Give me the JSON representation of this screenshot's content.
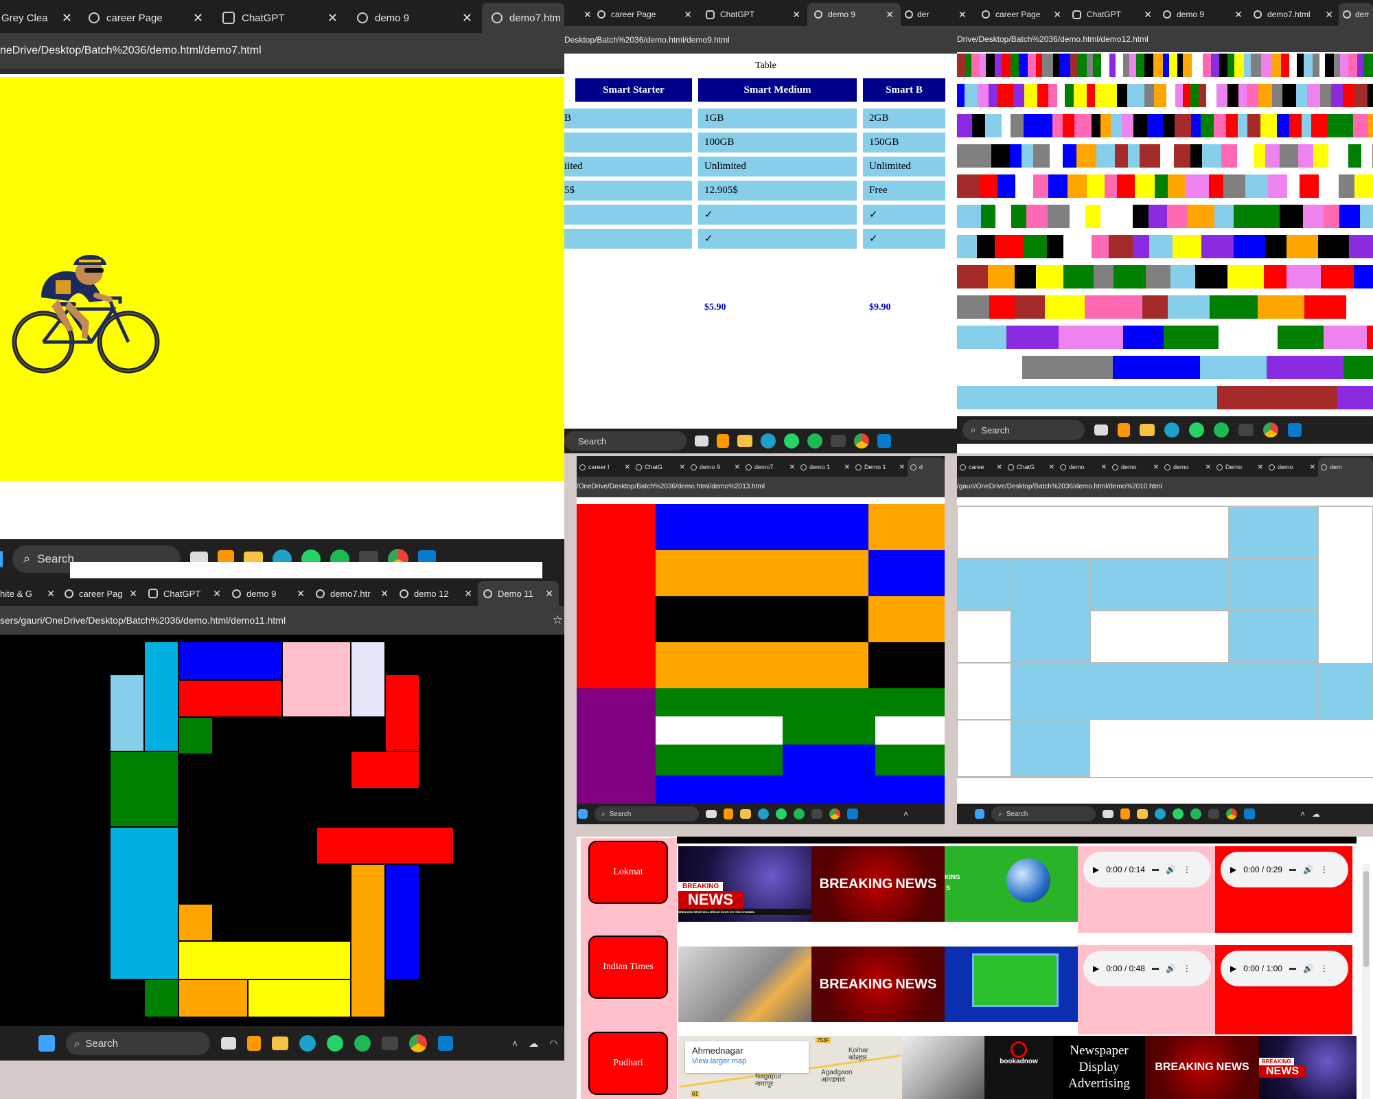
{
  "p1": {
    "tabs": [
      {
        "label": "Grey Clea",
        "icon": "none",
        "active": false
      },
      {
        "label": "career Page",
        "icon": "globe",
        "active": false
      },
      {
        "label": "ChatGPT",
        "icon": "gpt",
        "active": false
      },
      {
        "label": "demo 9",
        "icon": "globe",
        "active": false
      },
      {
        "label": "demo7.html",
        "icon": "globe",
        "active": true
      }
    ],
    "address": "neDrive/Desktop/Batch%2036/demo.html/demo7.html",
    "search_label": "Search",
    "cyclist_alt": "cyclist",
    "page_bg": "#ffff00"
  },
  "p2": {
    "tabs": [
      {
        "label": "",
        "icon": "none",
        "active": false
      },
      {
        "label": "career Page",
        "icon": "globe",
        "active": false
      },
      {
        "label": "ChatGPT",
        "icon": "gpt",
        "active": false
      },
      {
        "label": "demo 9",
        "icon": "globe",
        "active": true
      },
      {
        "label": "der",
        "icon": "globe",
        "active": false
      }
    ],
    "address": "Desktop/Batch%2036/demo.html/demo9.html",
    "caption": "Table",
    "headers": [
      "Smart Starter",
      "Smart Medium",
      "Smart B"
    ],
    "rows": [
      [
        "B",
        "1GB",
        "2GB"
      ],
      [
        "",
        "100GB",
        "150GB"
      ],
      [
        "iited",
        "Unlimited",
        "Unlimited"
      ],
      [
        "5$",
        "12.905$",
        "Free"
      ],
      [
        "",
        "✓",
        "✓"
      ],
      [
        "",
        "✓",
        "✓"
      ]
    ],
    "prices": [
      "",
      "$5.90",
      "$9.90"
    ],
    "search_label": "Search"
  },
  "p3": {
    "tabs": [
      {
        "label": "",
        "icon": "none",
        "active": false
      },
      {
        "label": "career Page",
        "icon": "globe",
        "active": false
      },
      {
        "label": "ChatGPT",
        "icon": "gpt",
        "active": false
      },
      {
        "label": "demo 9",
        "icon": "globe",
        "active": false
      },
      {
        "label": "demo7.html",
        "icon": "globe",
        "active": false
      },
      {
        "label": "dem",
        "icon": "globe",
        "active": true
      }
    ],
    "address": "Drive/Desktop/Batch%2036/demo.html/demo12.html",
    "search_label": "Search"
  },
  "p4": {
    "tabs": [
      {
        "label": "hite & G",
        "icon": "none",
        "active": false
      },
      {
        "label": "career Pag",
        "icon": "globe",
        "active": false
      },
      {
        "label": "ChatGPT",
        "icon": "gpt",
        "active": false
      },
      {
        "label": "demo 9",
        "icon": "globe",
        "active": false
      },
      {
        "label": "demo7.htr",
        "icon": "globe",
        "active": false
      },
      {
        "label": "demo 12",
        "icon": "globe",
        "active": false
      },
      {
        "label": "Demo 11",
        "icon": "globe",
        "active": true
      }
    ],
    "address": "sers/gauri/OneDrive/Desktop/Batch%2036/demo.html/demo11.html",
    "search_label": "Search"
  },
  "p5": {
    "tabs": [
      {
        "label": "career I",
        "icon": "globe",
        "active": false
      },
      {
        "label": "ChatG",
        "icon": "gpt",
        "active": false
      },
      {
        "label": "demo 9",
        "icon": "globe",
        "active": false
      },
      {
        "label": "demo7.",
        "icon": "globe",
        "active": false
      },
      {
        "label": "demo 1",
        "icon": "globe",
        "active": false
      },
      {
        "label": "Demo 1",
        "icon": "globe",
        "active": false
      },
      {
        "label": "d",
        "icon": "globe",
        "active": true
      }
    ],
    "address": "/OneDrive/Desktop/Batch%2036/demo.html/demo%2013.html",
    "search_label": "Search"
  },
  "p6": {
    "tabs": [
      {
        "label": "caree",
        "icon": "globe",
        "active": false
      },
      {
        "label": "ChatG",
        "icon": "gpt",
        "active": false
      },
      {
        "label": "demo",
        "icon": "globe",
        "active": false
      },
      {
        "label": "demo",
        "icon": "globe",
        "active": false
      },
      {
        "label": "demo",
        "icon": "globe",
        "active": false
      },
      {
        "label": "Demo",
        "icon": "globe",
        "active": false
      },
      {
        "label": "demo",
        "icon": "globe",
        "active": false
      },
      {
        "label": "dem",
        "icon": "globe",
        "active": true
      }
    ],
    "address": "/gauri/OneDrive/Desktop/Batch%2036/demo.html/demo%2010.html",
    "search_label": "Search"
  },
  "p7": {
    "channels": [
      "Lokmat",
      "Indian Times",
      "Pudhari"
    ],
    "audio": [
      [
        "0:00 / 0:14",
        "0:00 / 0:29"
      ],
      [
        "0:00 / 0:48",
        "0:00 / 1:00"
      ]
    ],
    "breaking": "BREAKING",
    "news": "NEWS",
    "breaking_news_a": "BREAKING",
    "breaking_news_b": "NEWS",
    "headline_small": "BREAKING NEWS WILL BREAK SOON ON THIS CHANNEL",
    "map": {
      "place": "Ahmednagar",
      "link": "View larger map",
      "town1": "Kolhar",
      "town1_local": "कोल्हार",
      "town2": "Agadgaon",
      "town2_local": "आगडगाव",
      "town3": "Nagapur",
      "town3_local": "नागापूर",
      "road": "753F",
      "road2": "61"
    },
    "bookad": "bookadnow",
    "newspaper_ad": "Newspaper Display Advertising",
    "green_label": "KING",
    "green_label2": "S"
  },
  "taskbar_main_search": "Search"
}
